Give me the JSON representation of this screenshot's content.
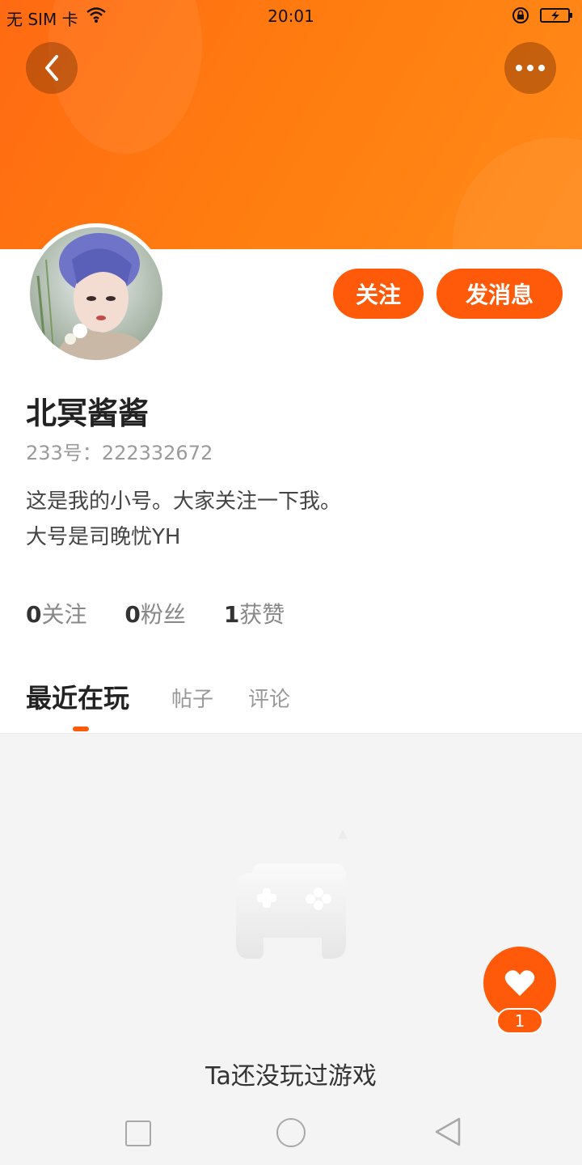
{
  "status_bar": {
    "carrier": "无 SIM 卡",
    "time": "20:01"
  },
  "profile": {
    "name": "北冥酱酱",
    "id_label": "233号：",
    "id_value": "222332672",
    "bio_line1": "这是我的小号。大家关注一下我。",
    "bio_line2": "大号是司晚忧YH"
  },
  "actions": {
    "follow": "关注",
    "message": "发消息"
  },
  "stats": [
    {
      "value": "0",
      "label": "关注"
    },
    {
      "value": "0",
      "label": "粉丝"
    },
    {
      "value": "1",
      "label": "获赞"
    }
  ],
  "tabs": [
    {
      "label": "最近在玩",
      "active": true
    },
    {
      "label": "帖子",
      "active": false
    },
    {
      "label": "评论",
      "active": false
    }
  ],
  "empty_state": {
    "text": "Ta还没玩过游戏"
  },
  "like": {
    "count": "1"
  },
  "colors": {
    "accent": "#ff5a0a",
    "header": "#ff7a10"
  }
}
